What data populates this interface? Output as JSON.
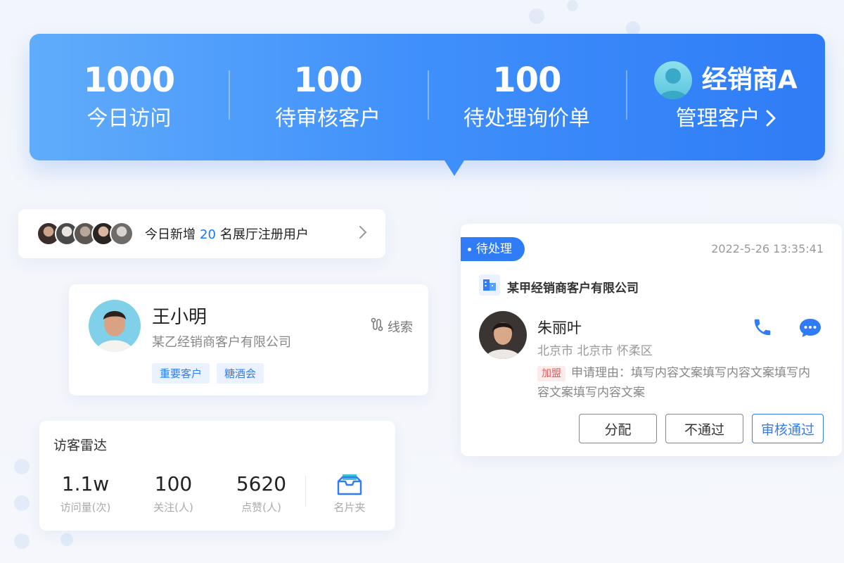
{
  "banner": {
    "stats": [
      {
        "value": "1000",
        "label": "今日访问"
      },
      {
        "value": "100",
        "label": "待审核客户"
      },
      {
        "value": "100",
        "label": "待处理询价单"
      }
    ],
    "dealer": {
      "name": "经销商A",
      "link_label": "管理客户"
    }
  },
  "new_users": {
    "prefix": "今日新增",
    "count": "20",
    "suffix": "名展厅注册用户"
  },
  "profile": {
    "name": "王小明",
    "company": "某乙经销商客户有限公司",
    "lead_label": "线索",
    "tags": [
      "重要客户",
      "糖酒会"
    ]
  },
  "radar": {
    "title": "访客雷达",
    "metrics": [
      {
        "value": "1.1w",
        "label": "访问量(次)"
      },
      {
        "value": "100",
        "label": "关注(人)"
      },
      {
        "value": "5620",
        "label": "点赞(人)"
      }
    ],
    "cardholder_label": "名片夹"
  },
  "pending": {
    "status": "待处理",
    "timestamp": "2022-5-26 13:35:41",
    "company": "某甲经销商客户有限公司",
    "person_name": "朱丽叶",
    "location": "北京市  北京市  怀柔区",
    "join_badge": "加盟",
    "reason": "申请理由：填写内容文案填写内容文案填写内容文案填写内容文案",
    "actions": {
      "assign": "分配",
      "reject": "不通过",
      "approve": "审核通过"
    }
  },
  "colors": {
    "primary": "#2f7cf6",
    "banner_start": "#60acfb",
    "banner_end": "#2f7cf6",
    "join_badge": "#ef5a5a"
  },
  "icons": {
    "dealer_avatar": "user-avatar-icon",
    "link_chevron": "chevron-right-icon",
    "lead": "route-icon",
    "cardholder": "inbox-icon",
    "company": "building-icon",
    "phone": "phone-icon",
    "message": "chat-bubble-icon"
  }
}
